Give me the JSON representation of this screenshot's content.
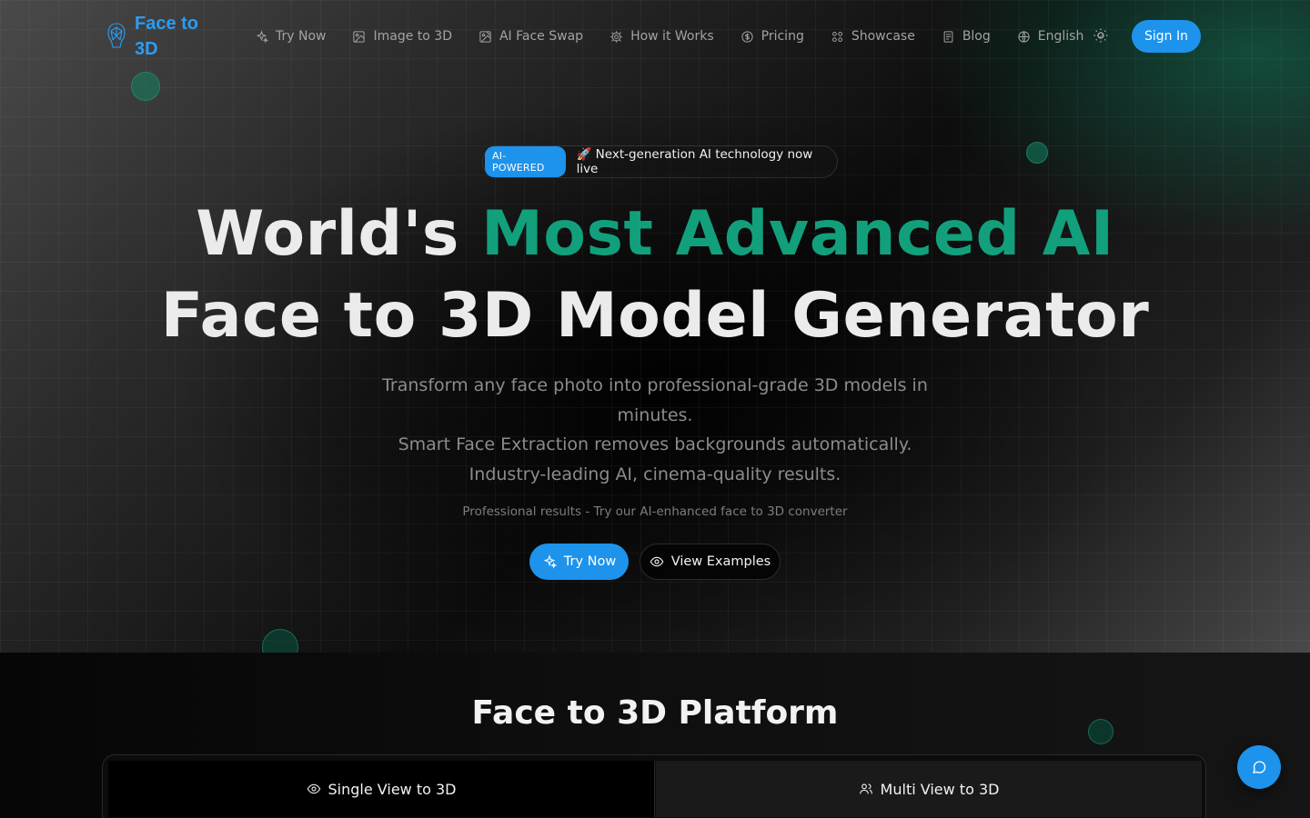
{
  "brand": {
    "name_line1": "Face to",
    "name_line2": "3D",
    "color": "#2a9df4"
  },
  "nav": {
    "items": [
      {
        "label": "Try Now",
        "icon": "sparkles-icon"
      },
      {
        "label": "Image to 3D",
        "icon": "image-icon"
      },
      {
        "label": "AI Face Swap",
        "icon": "image-edit-icon"
      },
      {
        "label": "How it Works",
        "icon": "gear-icon"
      },
      {
        "label": "Pricing",
        "icon": "dollar-circle-icon"
      },
      {
        "label": "Showcase",
        "icon": "grid-icon"
      },
      {
        "label": "Blog",
        "icon": "document-icon"
      }
    ],
    "language": "English",
    "sign_in": "Sign In"
  },
  "hero": {
    "badge_pill": "AI-POWERED",
    "badge_text": "🚀 Next-generation AI technology now live",
    "headline_part1": "World's ",
    "headline_accent": "Most Advanced AI",
    "headline_line2": "Face to 3D Model Generator",
    "subtitle_line1": "Transform any face photo into professional-grade 3D models in minutes.",
    "subtitle_line2": "Smart Face Extraction removes backgrounds automatically. Industry-leading AI, cinema-quality results.",
    "note": "Professional results - Try our AI-enhanced face to 3D converter",
    "primary_cta": "Try Now",
    "secondary_cta": "View Examples"
  },
  "platform": {
    "title": "Face to 3D Platform",
    "tabs": [
      {
        "label": "Single View to 3D",
        "icon": "eye-icon",
        "active": true
      },
      {
        "label": "Multi View to 3D",
        "icon": "users-icon",
        "active": false
      }
    ]
  },
  "colors": {
    "accent_blue": "#1d93ec",
    "accent_green": "#12a07c"
  }
}
